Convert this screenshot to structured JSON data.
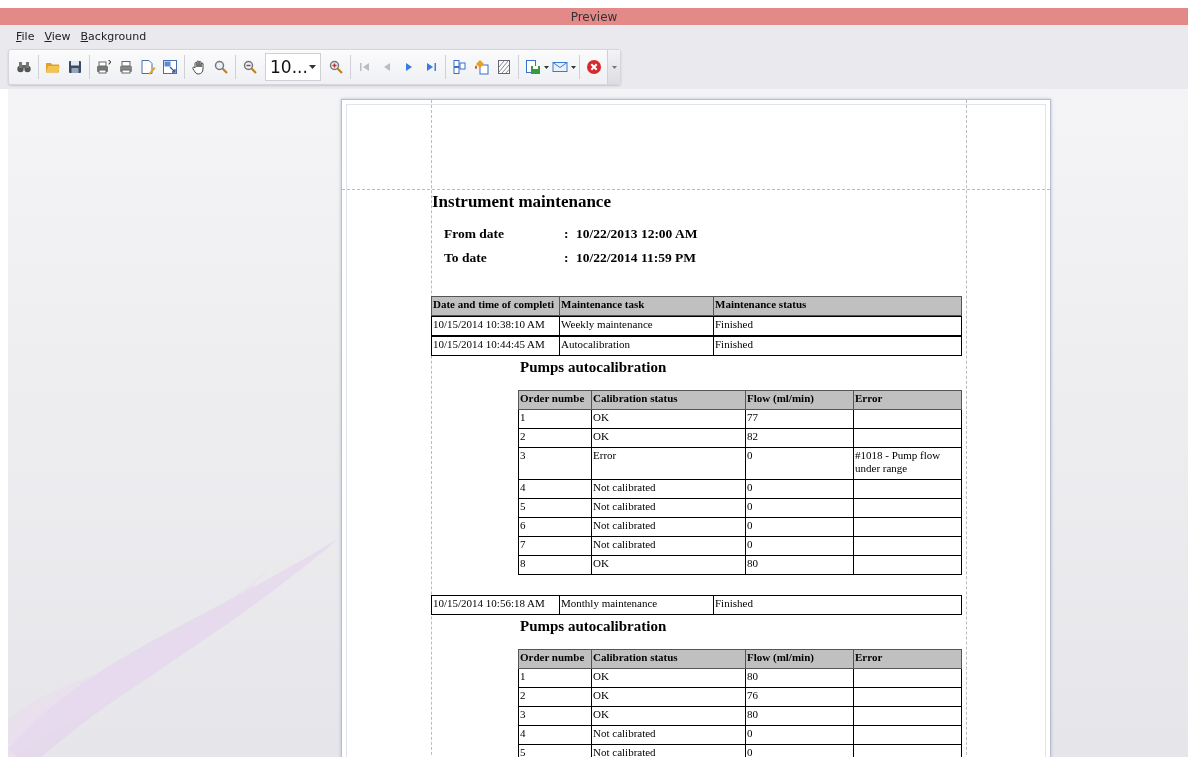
{
  "window": {
    "title": "Preview"
  },
  "menu": [
    {
      "label": "File"
    },
    {
      "label": "View"
    },
    {
      "label": "Background"
    }
  ],
  "toolbar": {
    "zoom_value": "10...",
    "navigation": [
      {
        "disabled": true
      },
      {
        "disabled": true
      },
      {
        "disabled": false
      },
      {
        "disabled": false
      }
    ]
  },
  "report": {
    "title": "Instrument maintenance",
    "date_fields": [
      {
        "label": "From date",
        "separator": ":",
        "value": "10/22/2013 12:00 AM"
      },
      {
        "label": "To date",
        "separator": ":",
        "value": "10/22/2014 11:59 PM"
      }
    ],
    "columns": [
      "Date and time of completi",
      "Maintenance task",
      "Maintenance status"
    ],
    "entries": [
      {
        "cells": [
          "10/15/2014 10:38:10 AM",
          "Weekly maintenance",
          "Finished"
        ]
      },
      {
        "cells": [
          "10/15/2014 10:44:45 AM",
          "Autocalibration",
          "Finished"
        ],
        "calibration": {
          "title": "Pumps autocalibration",
          "columns": [
            "Order numbe",
            "Calibration status",
            "Flow (ml/min)",
            "Error"
          ],
          "rows": [
            [
              "1",
              "OK",
              "77",
              ""
            ],
            [
              "2",
              "OK",
              "82",
              ""
            ],
            [
              "3",
              "Error",
              "0",
              "#1018 - Pump flow under range"
            ],
            [
              "4",
              "Not calibrated",
              "0",
              ""
            ],
            [
              "5",
              "Not calibrated",
              "0",
              ""
            ],
            [
              "6",
              "Not calibrated",
              "0",
              ""
            ],
            [
              "7",
              "Not calibrated",
              "0",
              ""
            ],
            [
              "8",
              "OK",
              "80",
              ""
            ]
          ]
        }
      },
      {
        "cells": [
          "10/15/2014 10:56:18 AM",
          "Monthly maintenance",
          "Finished"
        ],
        "calibration": {
          "title": "Pumps autocalibration",
          "columns": [
            "Order numbe",
            "Calibration status",
            "Flow (ml/min)",
            "Error"
          ],
          "rows": [
            [
              "1",
              "OK",
              "80",
              ""
            ],
            [
              "2",
              "OK",
              "76",
              ""
            ],
            [
              "3",
              "OK",
              "80",
              ""
            ],
            [
              "4",
              "Not calibrated",
              "0",
              ""
            ],
            [
              "5",
              "Not calibrated",
              "0",
              ""
            ]
          ]
        }
      }
    ]
  }
}
